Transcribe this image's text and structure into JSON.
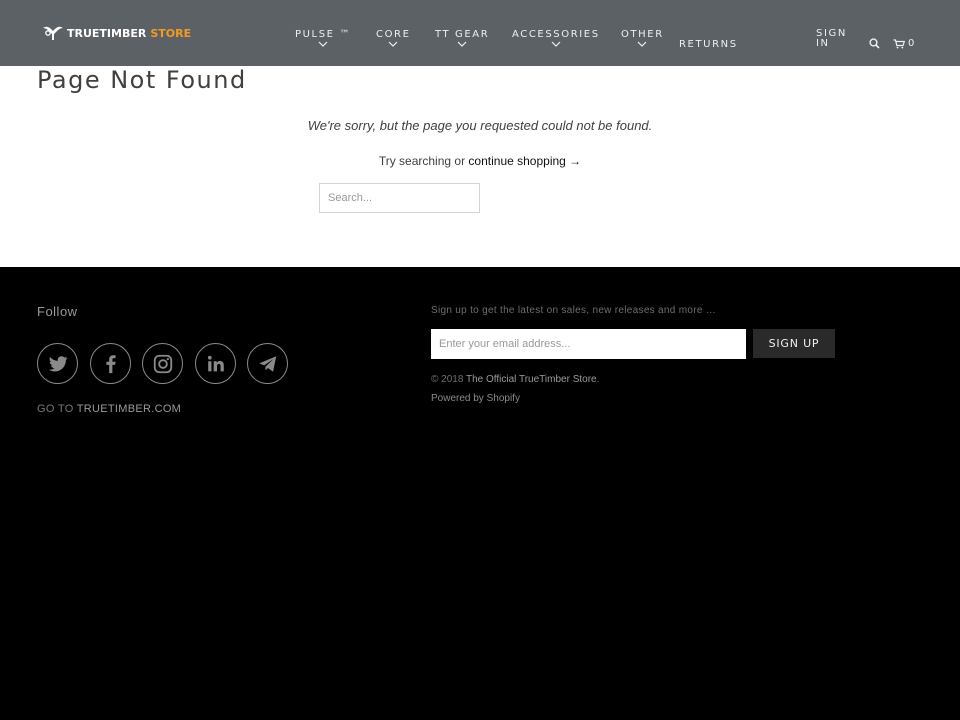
{
  "header": {
    "logo_text": "TRUETIMBER",
    "logo_store": "STORE",
    "nav": [
      {
        "label": "PULSE ™",
        "has_dropdown": true
      },
      {
        "label": "CORE",
        "has_dropdown": true
      },
      {
        "label": "TT GEAR",
        "has_dropdown": true
      },
      {
        "label": "ACCESSORIES",
        "has_dropdown": true
      },
      {
        "label": "OTHER",
        "has_dropdown": true
      }
    ],
    "returns_label": "RETURNS",
    "signin_line1": "SIGN",
    "signin_line2": "IN",
    "search_icon": "search-icon",
    "cart_icon": "cart-icon",
    "cart_count": "0"
  },
  "main": {
    "title": "Page Not Found",
    "sorry_text": "We're sorry, but the page you requested could not be found.",
    "try_text": "Try searching or ",
    "continue_link": "continue shopping →",
    "search_placeholder": "Search..."
  },
  "footer": {
    "follow_label": "Follow",
    "social": [
      "twitter-icon",
      "facebook-icon",
      "instagram-icon",
      "linkedin-icon",
      "telegram-icon"
    ],
    "goto_prefix": "GO TO ",
    "goto_link": "TRUETIMBER.COM",
    "signup_text": "Sign up to get the latest on sales, new releases and more …",
    "email_placeholder": "Enter your email address...",
    "signup_button": "SIGN UP",
    "copyright_prefix": "© 2018 ",
    "copyright_link": "The Official TrueTimber Store",
    "copyright_suffix": ".",
    "powered_by": "Powered by Shopify"
  },
  "colors": {
    "header_bg": "#5c6166",
    "accent": "#f39a21",
    "footer_bg": "#000000",
    "button_bg": "#2a2a2a"
  }
}
